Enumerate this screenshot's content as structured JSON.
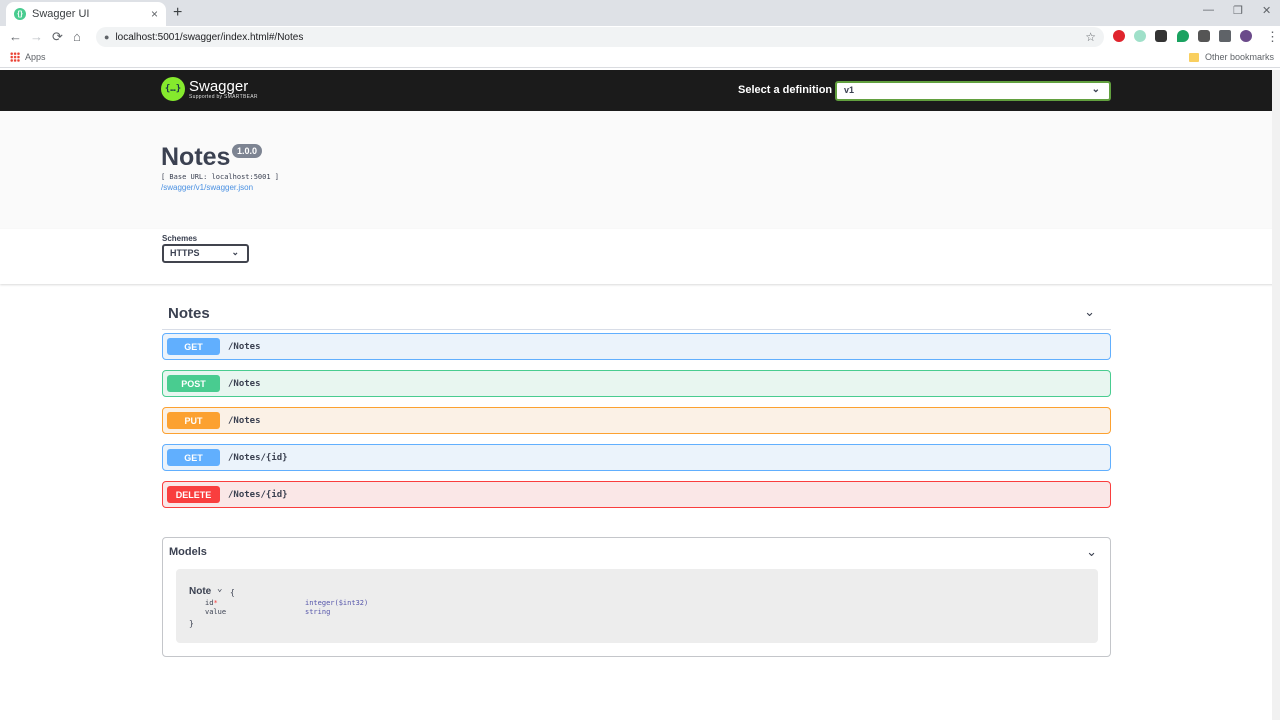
{
  "browser": {
    "tab_title": "Swagger UI",
    "tab_close": "×",
    "new_tab": "+",
    "url": "localhost:5001/swagger/index.html#/Notes",
    "bookmarks_apps": "Apps",
    "bookmarks_other": "Other bookmarks",
    "back": "←",
    "forward": "→",
    "reload": "⟳",
    "home": "⌂",
    "star": "☆",
    "lock": "🔒",
    "menu": "⋮",
    "minimize": "—",
    "maximize": "❐",
    "close": "✕"
  },
  "topbar": {
    "logo_name": "Swagger",
    "logo_sub": "Supported by SMARTBEAR",
    "logo_glyph": "{…}",
    "definition_label": "Select a definition",
    "definition_value": "v1"
  },
  "info": {
    "title": "Notes",
    "version": "1.0.0",
    "base_url": "[ Base URL: localhost:5001 ]",
    "spec_link": "/swagger/v1/swagger.json"
  },
  "schemes": {
    "label": "Schemes",
    "value": "HTTPS"
  },
  "tag": {
    "title": "Notes"
  },
  "operations": [
    {
      "method": "GET",
      "path": "/Notes"
    },
    {
      "method": "POST",
      "path": "/Notes"
    },
    {
      "method": "PUT",
      "path": "/Notes"
    },
    {
      "method": "GET",
      "path": "/Notes/{id}"
    },
    {
      "method": "DELETE",
      "path": "/Notes/{id}"
    }
  ],
  "models": {
    "title": "Models",
    "model_name": "Note",
    "open_brace": "{",
    "close_brace": "}",
    "properties": [
      {
        "name": "id",
        "required": "*",
        "type": "integer($int32)"
      },
      {
        "name": "value",
        "required": "",
        "type": "string"
      }
    ]
  },
  "colors": {
    "get": "#61affe",
    "post": "#49cc90",
    "put": "#fca130",
    "delete": "#f93e3e",
    "topbar": "#1b1b1b",
    "text": "#3b4151"
  }
}
